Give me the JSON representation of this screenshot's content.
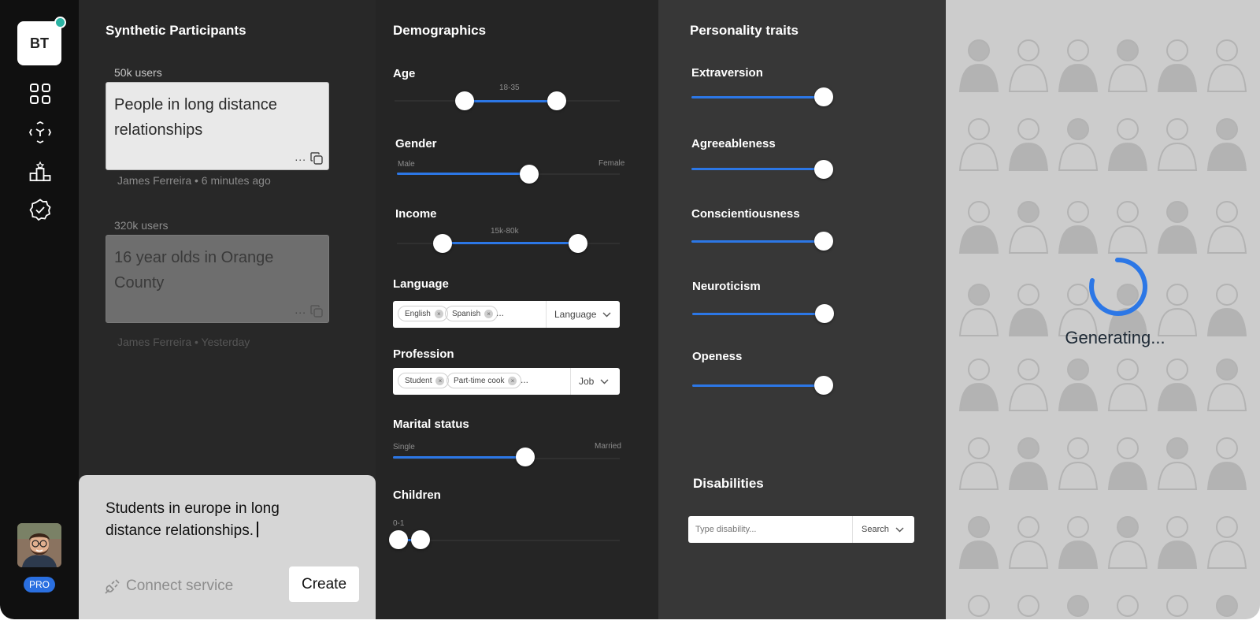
{
  "sidebar": {
    "logo_text": "BT",
    "nav_icons": [
      "grid-icon",
      "scan-icon",
      "podium-icon",
      "verified-badge-icon"
    ],
    "badge": "PRO"
  },
  "participants": {
    "title": "Synthetic Participants",
    "segments": [
      {
        "users": "50k users",
        "text": "People in long distance relationships",
        "meta": "James Ferreira • 6 minutes ago",
        "more": "..."
      },
      {
        "users": "320k users",
        "text": "16 year olds in Orange County",
        "meta": "James Ferreira • Yesterday",
        "more": "..."
      }
    ],
    "composer": {
      "text": "Students in europe in long distance relationships.",
      "connect_label": "Connect service",
      "create_label": "Create"
    }
  },
  "demographics": {
    "title": "Demographics",
    "age": {
      "label": "Age",
      "range_text": "18-35"
    },
    "gender": {
      "label": "Gender",
      "min_label": "Male",
      "max_label": "Female"
    },
    "income": {
      "label": "Income",
      "range_text": "15k-80k"
    },
    "language": {
      "label": "Language",
      "chips": [
        "English",
        "Spanish"
      ],
      "more": "...",
      "dropdown": "Language"
    },
    "profession": {
      "label": "Profession",
      "chips": [
        "Student",
        "Part-time cook"
      ],
      "more": "...",
      "dropdown": "Job"
    },
    "marital": {
      "label": "Marital status",
      "min_label": "Single",
      "max_label": "Married"
    },
    "children": {
      "label": "Children",
      "range_text": "0-1"
    }
  },
  "personality": {
    "title": "Personality traits",
    "traits": [
      {
        "label": "Extraversion"
      },
      {
        "label": "Agreeableness"
      },
      {
        "label": "Conscientiousness"
      },
      {
        "label": "Neuroticism"
      },
      {
        "label": "Openess"
      }
    ],
    "disabilities": {
      "title": "Disabilities",
      "placeholder": "Type disability...",
      "button": "Search"
    }
  },
  "generating": {
    "text": "Generating..."
  },
  "colors": {
    "accent": "#2c77e6",
    "badge": "#2a6fe0",
    "online": "#2bb3a3"
  }
}
